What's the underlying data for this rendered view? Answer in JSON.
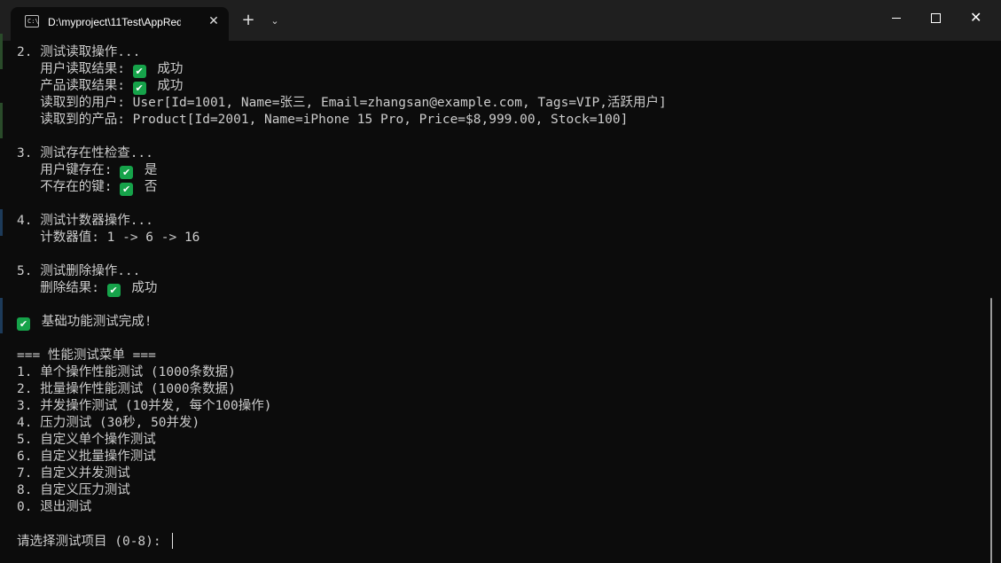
{
  "window": {
    "tab_title": "D:\\myproject\\11Test\\AppRedis",
    "tab_icon": "terminal-icon",
    "close_tab": "✕",
    "new_tab": "+",
    "dropdown": "⌄",
    "close_window": "✕"
  },
  "colors": {
    "background": "#0c0c0c",
    "titlebar": "#1f1f1f",
    "text": "#cccccc",
    "check": "#16a34a"
  },
  "terminal": {
    "lines": [
      {
        "text": "2. 测试读取操作..."
      },
      {
        "text": "   用户读取结果: ",
        "check": true,
        "after": " 成功"
      },
      {
        "text": "   产品读取结果: ",
        "check": true,
        "after": " 成功"
      },
      {
        "text": "   读取到的用户: User[Id=1001, Name=张三, Email=zhangsan@example.com, Tags=VIP,活跃用户]"
      },
      {
        "text": "   读取到的产品: Product[Id=2001, Name=iPhone 15 Pro, Price=$8,999.00, Stock=100]"
      },
      {
        "text": ""
      },
      {
        "text": "3. 测试存在性检查..."
      },
      {
        "text": "   用户键存在: ",
        "check": true,
        "after": " 是"
      },
      {
        "text": "   不存在的键: ",
        "check": true,
        "after": " 否"
      },
      {
        "text": ""
      },
      {
        "text": "4. 测试计数器操作..."
      },
      {
        "text": "   计数器值: 1 -> 6 -> 16"
      },
      {
        "text": ""
      },
      {
        "text": "5. 测试删除操作..."
      },
      {
        "text": "   删除结果: ",
        "check": true,
        "after": " 成功"
      },
      {
        "text": ""
      },
      {
        "text": "",
        "check": true,
        "after": " 基础功能测试完成!"
      },
      {
        "text": ""
      },
      {
        "text": "=== 性能测试菜单 ==="
      },
      {
        "text": "1. 单个操作性能测试 (1000条数据)"
      },
      {
        "text": "2. 批量操作性能测试 (1000条数据)"
      },
      {
        "text": "3. 并发操作测试 (10并发, 每个100操作)"
      },
      {
        "text": "4. 压力测试 (30秒, 50并发)"
      },
      {
        "text": "5. 自定义单个操作测试"
      },
      {
        "text": "6. 自定义批量操作测试"
      },
      {
        "text": "7. 自定义并发测试"
      },
      {
        "text": "8. 自定义压力测试"
      },
      {
        "text": "0. 退出测试"
      },
      {
        "text": ""
      },
      {
        "text": "请选择测试项目 (0-8): ",
        "cursor": true
      }
    ]
  }
}
